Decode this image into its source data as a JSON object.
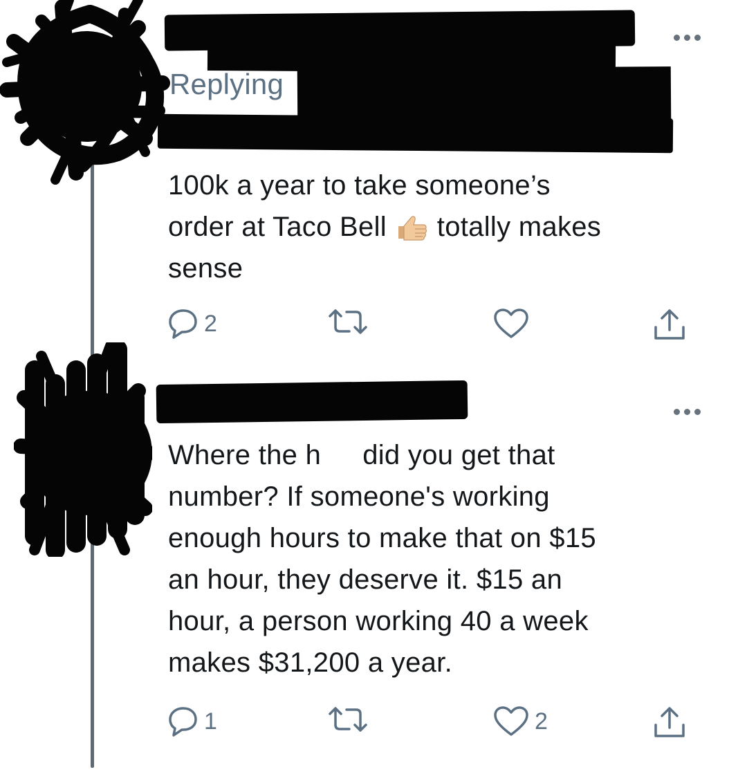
{
  "thread": {
    "tweets": [
      {
        "replying_prefix": "Replying",
        "text_before_emoji": "100k a year to take someone’s\norder at Taco Bell ",
        "emoji": "thumbs-up-icon",
        "text_after_emoji": " totally makes\nsense",
        "actions": {
          "reply_count": "2",
          "retweet_count": "",
          "like_count": "",
          "share_icon": "share-icon"
        }
      },
      {
        "text_part1": "Where the h",
        "text_part2": "did you get that\nnumber? If someone's working\nenough hours to make that on $15\nan hour, they deserve it. $15 an\nhour, a person working 40 a week\nmakes $31,200 a year.",
        "actions": {
          "reply_count": "1",
          "retweet_count": "",
          "like_count": "2",
          "share_icon": "share-icon"
        }
      }
    ]
  },
  "colors": {
    "text": "#14171a",
    "secondary": "#5b7083",
    "redaction": "#050505",
    "thread_line": "#5f6b74"
  }
}
